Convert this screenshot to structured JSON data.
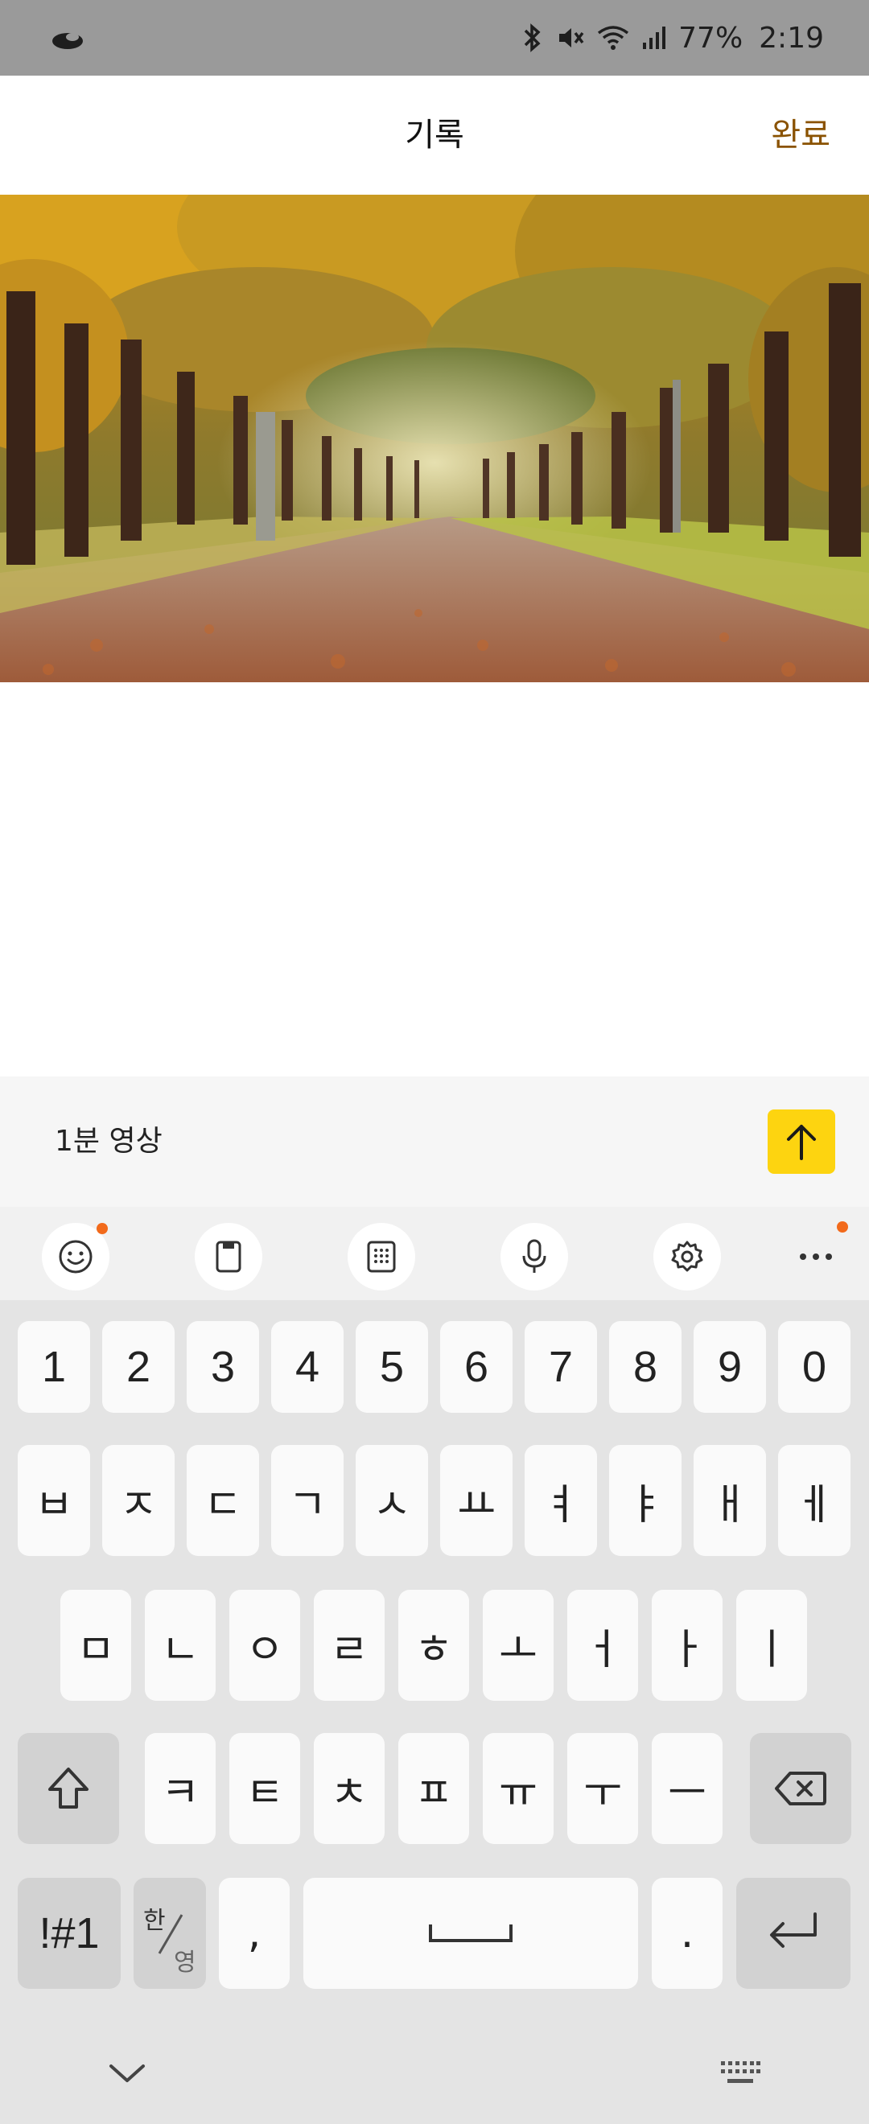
{
  "status_bar": {
    "battery": "77%",
    "time": "2:19",
    "icons": [
      "app-notification-icon",
      "bluetooth-icon",
      "mute-icon",
      "wifi-icon",
      "signal-icon"
    ]
  },
  "header": {
    "title": "기록",
    "done_label": "완료",
    "done_color": "#8a5200"
  },
  "caption": {
    "value": "1분 영상",
    "send_icon": "arrow-up-icon",
    "send_color": "#fdd410"
  },
  "keyboard_toolbar": {
    "items": [
      "emoji-icon",
      "clipboard-icon",
      "keypad-icon",
      "microphone-icon",
      "settings-icon",
      "more-icon"
    ]
  },
  "keyboard": {
    "row_numbers": [
      "1",
      "2",
      "3",
      "4",
      "5",
      "6",
      "7",
      "8",
      "9",
      "0"
    ],
    "row_1": [
      "ㅂ",
      "ㅈ",
      "ㄷ",
      "ㄱ",
      "ㅅ",
      "ㅛ",
      "ㅕ",
      "ㅑ",
      "ㅐ",
      "ㅔ"
    ],
    "row_2": [
      "ㅁ",
      "ㄴ",
      "ㅇ",
      "ㄹ",
      "ㅎ",
      "ㅗ",
      "ㅓ",
      "ㅏ",
      "ㅣ"
    ],
    "row_3": [
      "ㅋ",
      "ㅌ",
      "ㅊ",
      "ㅍ",
      "ㅠ",
      "ㅜ",
      "ㅡ"
    ],
    "symbols_label": "!#1",
    "lang_top": "한",
    "lang_bottom": "영",
    "comma": ",",
    "period": ".",
    "special_icons": [
      "shift-icon",
      "backspace-icon",
      "space-icon",
      "enter-icon",
      "hide-keyboard-icon",
      "keyboard-switch-icon"
    ]
  }
}
